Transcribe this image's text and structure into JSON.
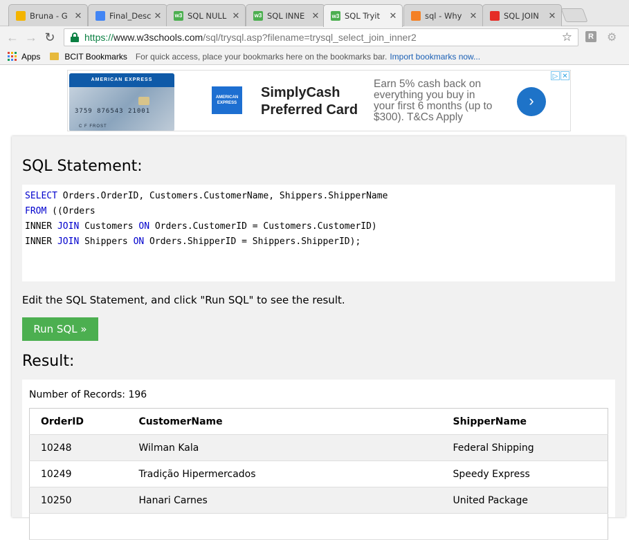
{
  "tabs": [
    {
      "label": "Bruna - G",
      "icon": "google-drive-icon",
      "color": "#f4b400",
      "active": false
    },
    {
      "label": "Final_Desc",
      "icon": "google-docs-icon",
      "color": "#4285f4",
      "active": false
    },
    {
      "label": "SQL NULL",
      "icon": "w3schools-icon",
      "color": "#4caf50",
      "active": false
    },
    {
      "label": "SQL INNE",
      "icon": "w3schools-icon",
      "color": "#4caf50",
      "active": false
    },
    {
      "label": "SQL Tryit",
      "icon": "w3schools-icon",
      "color": "#4caf50",
      "active": true
    },
    {
      "label": "sql - Why",
      "icon": "stackoverflow-icon",
      "color": "#f48024",
      "active": false
    },
    {
      "label": "SQL JOIN",
      "icon": "youtube-icon",
      "color": "#e52d27",
      "active": false
    }
  ],
  "tab_favicon_text": "w3",
  "url": {
    "https": "https://",
    "host": "www.w3schools.com",
    "path": "/sql/trysql.asp?filename=trysql_select_join_inner2"
  },
  "extension_label": "R",
  "bookmarks": {
    "apps": "Apps",
    "folder": "BCIT Bookmarks",
    "hint": "For quick access, place your bookmarks here on the bookmarks bar.",
    "import_link": "Import bookmarks now..."
  },
  "ad": {
    "card_brand": "AMERICAN EXPRESS",
    "card_number": "3759 876543 21001",
    "card_name": "C F FROST",
    "logo_text": "AMERICAN EXPRESS",
    "title": "SimplyCash Preferred Card",
    "copy": "Earn 5% cash back on everything you buy in your first 6 months (up to $300). T&Cs Apply",
    "cta": "›"
  },
  "sql_section": {
    "title": "SQL Statement:",
    "lines": [
      [
        {
          "t": "SELECT",
          "kw": true
        },
        {
          "t": " Orders.OrderID, Customers.CustomerName, Shippers.ShipperName",
          "kw": false
        }
      ],
      [
        {
          "t": "FROM",
          "kw": true
        },
        {
          "t": " ((Orders",
          "kw": false
        }
      ],
      [
        {
          "t": "INNER ",
          "kw": false
        },
        {
          "t": "JOIN",
          "kw": true
        },
        {
          "t": " Customers ",
          "kw": false
        },
        {
          "t": "ON",
          "kw": true
        },
        {
          "t": " Orders.CustomerID = Customers.CustomerID)",
          "kw": false
        }
      ],
      [
        {
          "t": "INNER ",
          "kw": false
        },
        {
          "t": "JOIN",
          "kw": true
        },
        {
          "t": " Shippers ",
          "kw": false
        },
        {
          "t": "ON",
          "kw": true
        },
        {
          "t": " Orders.ShipperID = Shippers.ShipperID);",
          "kw": false
        }
      ]
    ],
    "instruction": "Edit the SQL Statement, and click \"Run SQL\" to see the result.",
    "run_button": "Run SQL »"
  },
  "result": {
    "title": "Result:",
    "records": "Number of Records: 196",
    "columns": [
      "OrderID",
      "CustomerName",
      "ShipperName"
    ],
    "rows": [
      [
        "10248",
        "Wilman Kala",
        "Federal Shipping"
      ],
      [
        "10249",
        "Tradição Hipermercados",
        "Speedy Express"
      ],
      [
        "10250",
        "Hanari Carnes",
        "United Package"
      ],
      [
        "",
        "",
        ""
      ]
    ]
  },
  "colors": {
    "keyword": "#0000cd",
    "run_button": "#4caf50",
    "secure_green": "#0b8043"
  }
}
